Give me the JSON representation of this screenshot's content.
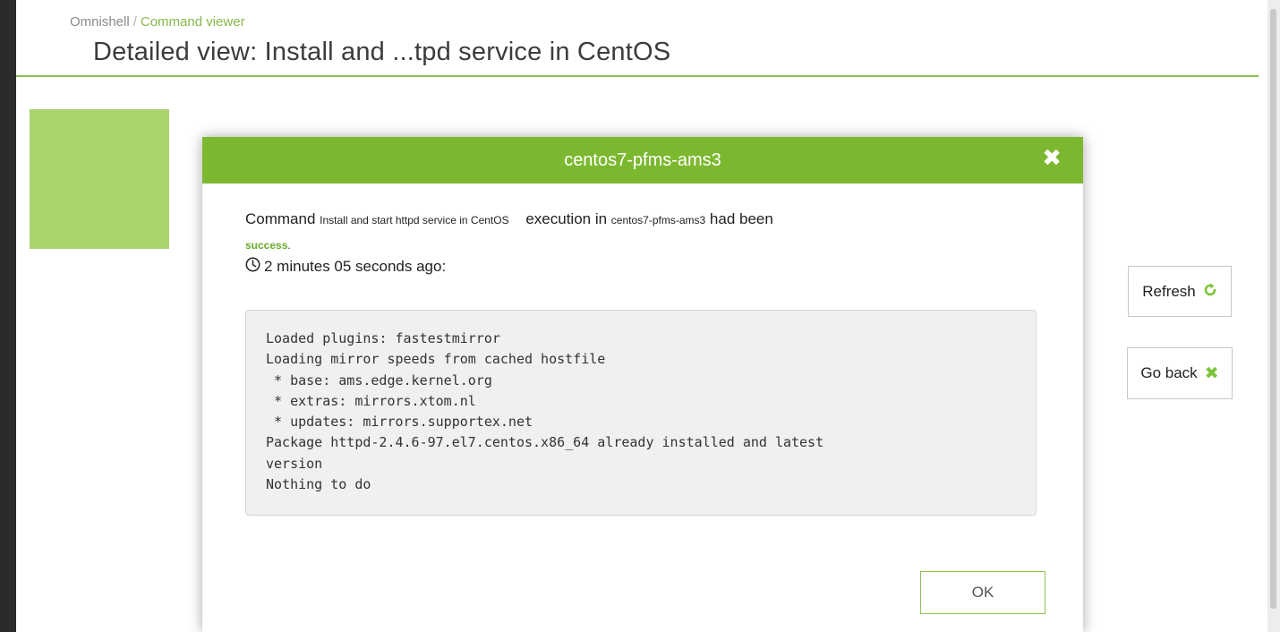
{
  "breadcrumb": {
    "root": "Omnishell",
    "separator": "/",
    "current": "Command viewer"
  },
  "page_title": "Detailed view: Install and ...tpd service in CentOS",
  "side_buttons": {
    "refresh_label": "Refresh",
    "refresh_icon": "refresh-icon",
    "goback_label": "Go back",
    "goback_icon": "close-icon"
  },
  "modal": {
    "title": "centos7-pfms-ams3",
    "close_icon": "close-icon",
    "message": {
      "prefix": "Command",
      "command_name": "Install and start httpd service in CentOS",
      "middle": "execution in",
      "host": "centos7-pfms-ams3",
      "suffix": "had been",
      "status": "success",
      "status_punct": "."
    },
    "time_ago": "2 minutes 05 seconds ago:",
    "output_lines": [
      "Loaded plugins: fastestmirror",
      "Loading mirror speeds from cached hostfile",
      " * base: ams.edge.kernel.org",
      " * extras: mirrors.xtom.nl",
      " * updates: mirrors.supportex.net",
      "Package httpd-2.4.6-97.el7.centos.x86_64 already installed and latest",
      "version",
      "Nothing to do"
    ],
    "ok_label": "OK"
  },
  "colors": {
    "accent_green": "#7cb82f",
    "tile_green": "#a9d46e",
    "success_green": "#6aaa2a"
  }
}
